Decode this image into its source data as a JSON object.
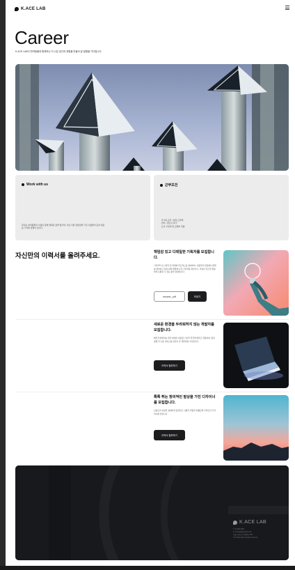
{
  "header": {
    "logo_text": "K.ACE LAB",
    "menu_icon": "hamburger-icon"
  },
  "intro": {
    "title": "Career",
    "subtitle": "K.ACE LAB이 반려동물과 함께하는 더 나은 공간과 경험을 만들어 갈 팀원을 기다립니다."
  },
  "cards": [
    {
      "title": "Work with us",
      "body": "우리는 반려동물과 사람이 함께 행복한 삶을 꿈꾸며, 서로 다른 전문성을 가진 사람들이 모여 새로운 가치를 만들어 갑니다."
    },
    {
      "title": "근무조건",
      "body": "· 주 5일 근무 / 유연 근무제\n· 연차 / 경조사 휴가\n· 도서 구입비 및 교육비 지원"
    }
  ],
  "section": {
    "title": "자신만의 이력서를 올려주세요."
  },
  "positions": [
    {
      "heading": "책임감 있고 디테일한 기획자를 모집합니다.",
      "description": "기획부터 출시까지 전 과정에 주도적으로 참여하며, 사용자의 입장에서 문제를 정의하고 팀과 함께 해결해 나갈 기획자를 찾습니다. 다양한 직군과 원활하게 소통할 수 있는 분을 환영합니다.",
      "file_button": "resume_.pdf",
      "submit_button": "보내기",
      "photo_icon": "lightbulb-icon"
    },
    {
      "heading": "새로운 환경을 두려워하지 않는 개발자를 모집합니다.",
      "description": "빠르게 변화하는 환경 속에서 새로운 기술을 즐겁게 배우고 적용하며, 팀과 함께 더 나은 서비스를 만들어 갈 개발자를 기다립니다.",
      "action_button": "이력서 첨부하기",
      "photo_icon": "laptop-icon"
    },
    {
      "heading": "톡톡 튀는 창의적인 발상을 가진 디자이너를 모집합니다.",
      "description": "브랜드의 감성을 섬세하게 표현하고 사용자 경험을 아름답게 디자인할 디자이너를 찾습니다.",
      "action_button": "이력서 첨부하기",
      "photo_icon": "sunset-icon"
    }
  ],
  "footer": {
    "logo_text": "K.ACE LAB",
    "info_lines": [
      "T. 02-000-0000",
      "E. contact@kacelab.com",
      "서울시 강남구 테헤란로 000",
      "© K.ACE LAB. All rights reserved."
    ]
  },
  "colors": {
    "dark": "#1d1d1f",
    "card_bg": "#ececec",
    "footer_bg": "#18191c"
  }
}
